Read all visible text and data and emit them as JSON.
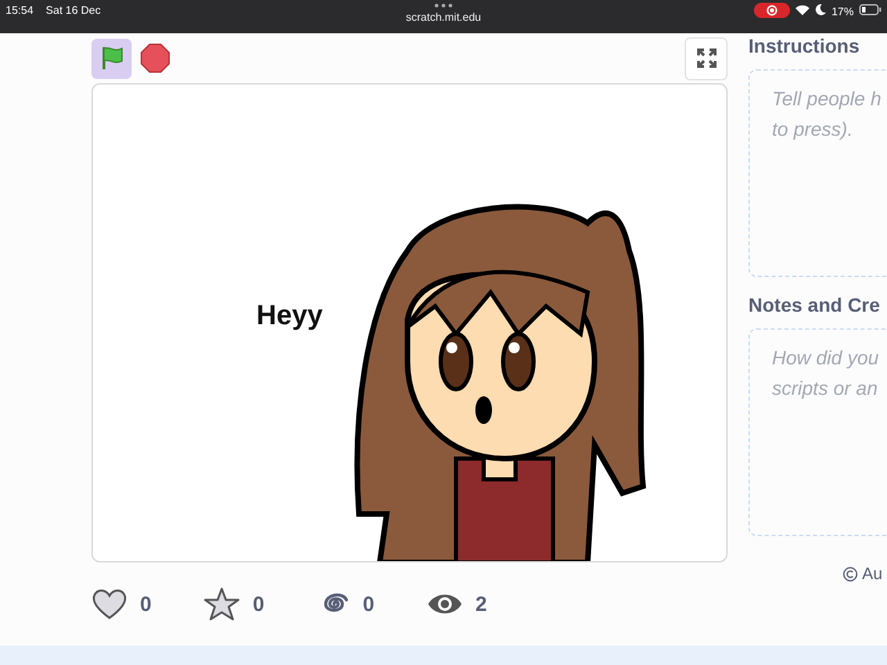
{
  "status_bar": {
    "time": "15:54",
    "date": "Sat 16 Dec",
    "url": "scratch.mit.edu",
    "battery": "17%"
  },
  "player": {
    "green_flag_active": true,
    "stage_text": "Heyy"
  },
  "stats": [
    {
      "kind": "love",
      "count": "0"
    },
    {
      "kind": "favorite",
      "count": "0"
    },
    {
      "kind": "remix",
      "count": "0"
    },
    {
      "kind": "view",
      "count": "2"
    }
  ],
  "sidebar": [
    {
      "title": "Instructions",
      "placeholder_lines": [
        "Tell people h",
        "to press)."
      ]
    },
    {
      "title": "Notes and Cre",
      "placeholder_lines": [
        "How did you",
        "scripts or an"
      ]
    }
  ],
  "license": "Au"
}
